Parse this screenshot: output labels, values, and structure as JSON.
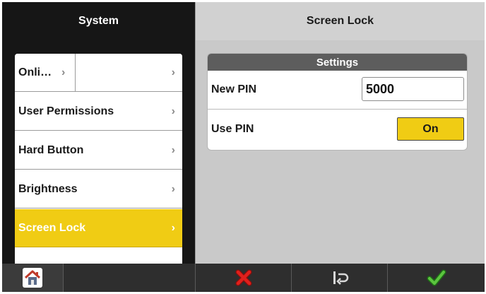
{
  "left_header": {
    "title": "System"
  },
  "right_header": {
    "title": "Screen Lock"
  },
  "menu": {
    "items": [
      {
        "label": "Onli…",
        "chevron": "›",
        "secondary_chevron": "›"
      },
      {
        "label": "User Permissions",
        "chevron": "›"
      },
      {
        "label": "Hard Button",
        "chevron": "›"
      },
      {
        "label": "Brightness",
        "chevron": "›"
      },
      {
        "label": "Screen Lock",
        "chevron": "›",
        "active": true
      }
    ]
  },
  "settings": {
    "title": "Settings",
    "new_pin": {
      "label": "New PIN",
      "value": "5000"
    },
    "use_pin": {
      "label": "Use PIN",
      "value": "On"
    }
  },
  "toolbar": {
    "buttons": [
      "home-icon",
      "cancel-icon",
      "reset-icon",
      "confirm-icon"
    ]
  },
  "colors": {
    "accent": "#f0cc14",
    "header_dark": "#161616",
    "toolbar": "#2e2e2e",
    "cancel": "#e0201c",
    "confirm": "#3fae2a"
  }
}
